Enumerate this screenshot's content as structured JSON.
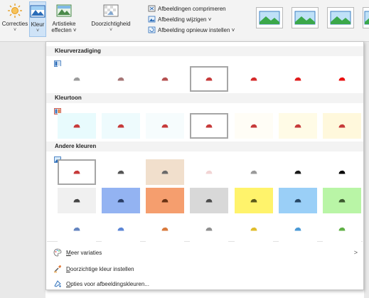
{
  "ribbon": {
    "correcties": "Correcties",
    "kleur": "Kleur",
    "artistieke_line1": "Artistieke",
    "artistieke_line2": "effecten ˅",
    "doorzichtigheid": "Doorzichtigheid",
    "dropdown_caret": "˅",
    "small": [
      {
        "label": "Afbeeldingen comprimeren",
        "icon": "compress-icon"
      },
      {
        "label": "Afbeelding wijzigen ˅",
        "icon": "change-picture-icon"
      },
      {
        "label": "Afbeelding opnieuw instellen  ˅",
        "icon": "reset-picture-icon"
      }
    ]
  },
  "panel": {
    "saturation_title": "Kleurverzadiging",
    "tone_title": "Kleurtoon",
    "recolor_title": "Andere kleuren",
    "saturation_cells": [
      {
        "bg": "#ffffff",
        "car": "#9c9c9c"
      },
      {
        "bg": "#ffffff",
        "car": "#a67676"
      },
      {
        "bg": "#ffffff",
        "car": "#b55050"
      },
      {
        "bg": "#ffffff",
        "car": "#c63a3a",
        "selected": true
      },
      {
        "bg": "#ffffff",
        "car": "#d52a2a"
      },
      {
        "bg": "#ffffff",
        "car": "#e01d1d"
      },
      {
        "bg": "#ffffff",
        "car": "#ea1010"
      }
    ],
    "tone_cells": [
      {
        "bg": "#e8fbfd",
        "car": "#c73a3a"
      },
      {
        "bg": "#eefbfd",
        "car": "#c63a3a"
      },
      {
        "bg": "#f6fcfd",
        "car": "#c63a3a"
      },
      {
        "bg": "#ffffff",
        "car": "#c63a3a",
        "selected": true
      },
      {
        "bg": "#fffdf6",
        "car": "#c63a3a"
      },
      {
        "bg": "#fffbe6",
        "car": "#c63a3a"
      },
      {
        "bg": "#fff8dc",
        "car": "#c63a3a"
      }
    ],
    "recolor_rows": [
      [
        {
          "bg": "#ffffff",
          "car": "#c63a3a",
          "selected": true
        },
        {
          "bg": "#ffffff",
          "car": "#555555"
        },
        {
          "bg": "#f1dfcc",
          "car": "#6a6a6a"
        },
        {
          "bg": "#ffffff",
          "car": "#f2d4d4"
        },
        {
          "bg": "#ffffff",
          "car": "#9a9a9a"
        },
        {
          "bg": "#ffffff",
          "car": "#1a1a1a"
        },
        {
          "bg": "#ffffff",
          "car": "#000000"
        }
      ],
      [
        {
          "bg": "#f0f0f0",
          "car": "#454545"
        },
        {
          "bg": "#93b3f2",
          "car": "#2a3e66"
        },
        {
          "bg": "#f59e6e",
          "car": "#6a3314"
        },
        {
          "bg": "#d8d8d8",
          "car": "#4c4c4c"
        },
        {
          "bg": "#fff36b",
          "car": "#5d5a1b"
        },
        {
          "bg": "#9acff7",
          "car": "#274766"
        },
        {
          "bg": "#b9f5a6",
          "car": "#3c5a2f"
        }
      ],
      [
        {
          "bg": "#ffffff",
          "car": "#6485c0"
        },
        {
          "bg": "#ffffff",
          "car": "#5c86d6"
        },
        {
          "bg": "#ffffff",
          "car": "#d97a3d"
        },
        {
          "bg": "#ffffff",
          "car": "#8f8f8f"
        },
        {
          "bg": "#ffffff",
          "car": "#e0bd2c"
        },
        {
          "bg": "#ffffff",
          "car": "#4b9ad6"
        },
        {
          "bg": "#ffffff",
          "car": "#60b046"
        }
      ]
    ],
    "menu": [
      {
        "label": "Meer variaties",
        "underline": "M",
        "rest": "eer variaties",
        "icon": "palette-icon",
        "has_submenu": true,
        "chevron": ">"
      },
      {
        "label": "Doorzichtige kleur instellen",
        "underline": "D",
        "rest": "oorzichtige kleur instellen",
        "icon": "eyedropper-icon",
        "has_submenu": false
      },
      {
        "label": "Opties voor afbeeldingskleuren...",
        "underline": "O",
        "rest": "pties voor afbeeldingskleuren...",
        "icon": "paint-icon",
        "has_submenu": false
      }
    ]
  },
  "colors": {
    "ribbon_bg": "#f3f3f3",
    "selected_button": "#cfe3f7",
    "selection_border": "#a6a6a6",
    "section_header_bg": "#f3f3f3"
  }
}
